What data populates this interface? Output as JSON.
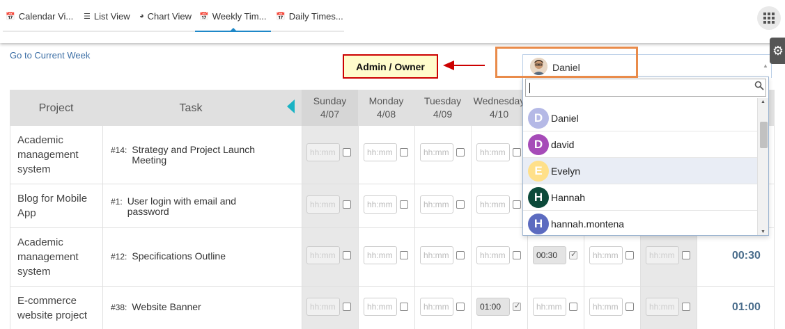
{
  "tabs": [
    {
      "label": "Calendar Vi...",
      "icon": "calendar-icon"
    },
    {
      "label": "List View",
      "icon": "list-icon"
    },
    {
      "label": "Chart View",
      "icon": "pie-chart-icon"
    },
    {
      "label": "Weekly Tim...",
      "icon": "calendar-icon",
      "active": true
    },
    {
      "label": "Daily Times...",
      "icon": "calendar-icon"
    }
  ],
  "go_current_week": "Go to Current Week",
  "callout": "Admin / Owner",
  "user_select": {
    "selected": "Daniel",
    "search_value": ""
  },
  "dropdown_users": [
    {
      "initial": "D",
      "name": "Daniel",
      "color": "#b5b9e6"
    },
    {
      "initial": "D",
      "name": "david",
      "color": "#a64bb8"
    },
    {
      "initial": "E",
      "name": "Evelyn",
      "color": "#ffe08a"
    },
    {
      "initial": "H",
      "name": "Hannah",
      "color": "#0c4a3a"
    },
    {
      "initial": "H",
      "name": "hannah.montena",
      "color": "#5c6bc0"
    }
  ],
  "table": {
    "headers": {
      "project": "Project",
      "task": "Task"
    },
    "days": [
      {
        "name": "Sunday",
        "date": "4/07"
      },
      {
        "name": "Monday",
        "date": "4/08"
      },
      {
        "name": "Tuesday",
        "date": "4/09"
      },
      {
        "name": "Wednesday",
        "date": "4/10"
      }
    ],
    "time_placeholder": "hh:mm",
    "rows": [
      {
        "project": "Academic management system",
        "task_num": "#14:",
        "task": "Strategy and Project Launch Meeting",
        "cells": [
          "",
          "",
          "",
          "",
          "",
          "",
          ""
        ],
        "total": ""
      },
      {
        "project": "Blog for Mobile App",
        "task_num": "#1:",
        "task": "User login with email and password",
        "cells": [
          "",
          "",
          "",
          "",
          "",
          "",
          ""
        ],
        "total": ""
      },
      {
        "project": "Academic management system",
        "task_num": "#12:",
        "task": "Specifications Outline",
        "cells": [
          "",
          "",
          "",
          "",
          "00:30",
          "",
          ""
        ],
        "total": "00:30"
      },
      {
        "project": "E-commerce website project",
        "task_num": "#38:",
        "task": "Website Banner",
        "cells": [
          "",
          "",
          "",
          "01:00",
          "",
          "",
          ""
        ],
        "total": "01:00"
      }
    ]
  }
}
